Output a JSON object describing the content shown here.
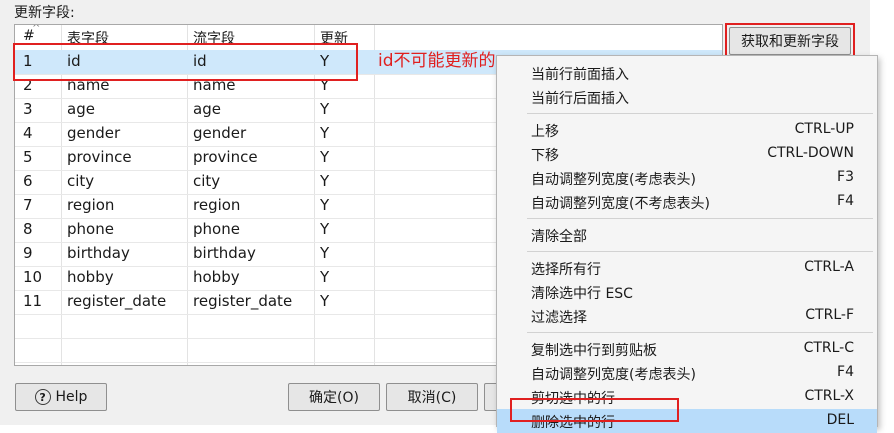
{
  "section_label": "更新字段:",
  "table": {
    "headers": [
      "#",
      "表字段",
      "流字段",
      "更新"
    ],
    "rows": [
      [
        "1",
        "id",
        "id",
        "Y"
      ],
      [
        "2",
        "name",
        "name",
        "Y"
      ],
      [
        "3",
        "age",
        "age",
        "Y"
      ],
      [
        "4",
        "gender",
        "gender",
        "Y"
      ],
      [
        "5",
        "province",
        "province",
        "Y"
      ],
      [
        "6",
        "city",
        "city",
        "Y"
      ],
      [
        "7",
        "region",
        "region",
        "Y"
      ],
      [
        "8",
        "phone",
        "phone",
        "Y"
      ],
      [
        "9",
        "birthday",
        "birthday",
        "Y"
      ],
      [
        "10",
        "hobby",
        "hobby",
        "Y"
      ],
      [
        "11",
        "register_date",
        "register_date",
        "Y"
      ]
    ]
  },
  "annotation_text": "id不可能更新的",
  "buttons": {
    "get_fields": "获取和更新字段",
    "help": "Help",
    "ok": "确定(O)",
    "cancel": "取消(C)"
  },
  "context_menu": {
    "groups": [
      [
        {
          "label": "当前行前面插入",
          "shortcut": ""
        },
        {
          "label": "当前行后面插入",
          "shortcut": ""
        }
      ],
      [
        {
          "label": "上移",
          "shortcut": "CTRL-UP"
        },
        {
          "label": "下移",
          "shortcut": "CTRL-DOWN"
        },
        {
          "label": "自动调整列宽度(考虑表头)",
          "shortcut": "F3"
        },
        {
          "label": "自动调整列宽度(不考虑表头)",
          "shortcut": "F4"
        }
      ],
      [
        {
          "label": "清除全部",
          "shortcut": ""
        }
      ],
      [
        {
          "label": "选择所有行",
          "shortcut": "CTRL-A"
        },
        {
          "label": "清除选中行 ESC",
          "shortcut": ""
        },
        {
          "label": "过滤选择",
          "shortcut": "CTRL-F"
        }
      ],
      [
        {
          "label": "复制选中行到剪贴板",
          "shortcut": "CTRL-C"
        },
        {
          "label": "自动调整列宽度(考虑表头)",
          "shortcut": "F4"
        },
        {
          "label": "剪切选中的行",
          "shortcut": "CTRL-X"
        },
        {
          "label": "删除选中的行",
          "shortcut": "DEL"
        }
      ]
    ],
    "highlighted_item": "删除选中的行"
  },
  "colors": {
    "annotation": "#e02020",
    "selected_row": "#cfe8fb",
    "menu_highlight": "#b8dcfa"
  }
}
